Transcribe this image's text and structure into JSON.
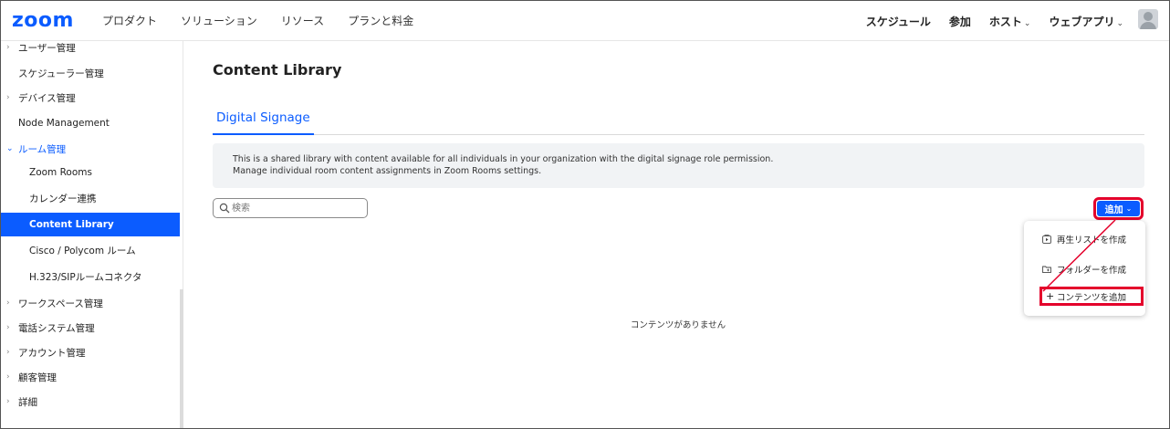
{
  "brand": {
    "logo": "zoom",
    "color": "#0b5cff"
  },
  "topnav": {
    "left": [
      "プロダクト",
      "ソリューション",
      "リソース",
      "プランと料金"
    ],
    "right": [
      {
        "label": "スケジュール",
        "caret": false
      },
      {
        "label": "参加",
        "caret": false
      },
      {
        "label": "ホスト",
        "caret": true
      },
      {
        "label": "ウェブアプリ",
        "caret": true
      }
    ]
  },
  "sidebar": {
    "items": [
      {
        "label": "ユーザー管理",
        "chevron": "›",
        "sub": false
      },
      {
        "label": "スケジューラー管理",
        "chevron": "",
        "sub": false
      },
      {
        "label": "デバイス管理",
        "chevron": "›",
        "sub": false
      },
      {
        "label": "Node Management",
        "chevron": "",
        "sub": false
      },
      {
        "label": "ルーム管理",
        "chevron": "⌄",
        "sub": false,
        "open": true
      },
      {
        "label": "Zoom Rooms",
        "sub": true
      },
      {
        "label": "カレンダー連携",
        "sub": true
      },
      {
        "label": "Content Library",
        "sub": true,
        "active": true
      },
      {
        "label": "Cisco / Polycom ルーム",
        "sub": true
      },
      {
        "label": "H.323/SIPルームコネクタ",
        "sub": true
      },
      {
        "label": "ワークスペース管理",
        "chevron": "›",
        "sub": false
      },
      {
        "label": "電話システム管理",
        "chevron": "›",
        "sub": false
      },
      {
        "label": "アカウント管理",
        "chevron": "›",
        "sub": false
      },
      {
        "label": "顧客管理",
        "chevron": "›",
        "sub": false
      },
      {
        "label": "詳細",
        "chevron": "›",
        "sub": false
      }
    ]
  },
  "main": {
    "title": "Content Library",
    "tab": "Digital Signage",
    "info_line1": "This is a shared library with content available for all individuals in your organization with the digital signage role permission.",
    "info_line2": "Manage individual room content assignments in Zoom Rooms settings.",
    "search_placeholder": "検索",
    "empty_text": "コンテンツがありません",
    "add_label": "追加",
    "menu": [
      {
        "label": "再生リストを作成",
        "icon": "playlist-icon"
      },
      {
        "label": "フォルダーを作成",
        "icon": "folder-add-icon"
      },
      {
        "label": "コンテンツを追加",
        "icon": "plus-icon"
      }
    ]
  },
  "colors": {
    "accent": "#0b5cff",
    "highlight": "#e4002b",
    "info_bg": "#f1f3f5"
  }
}
